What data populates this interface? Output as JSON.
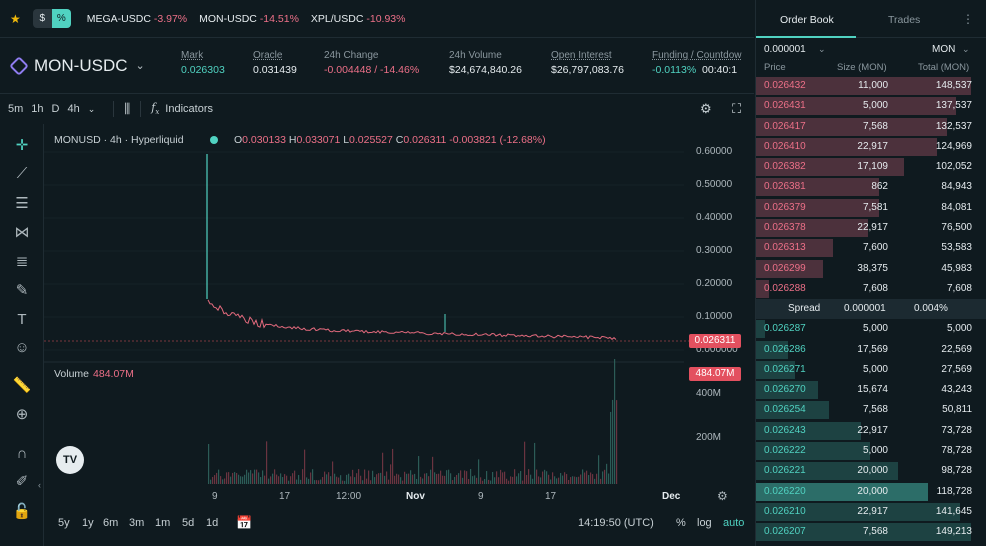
{
  "topbar": {
    "toggle_left": "$",
    "toggle_right": "%",
    "tickers": [
      {
        "symbol": "MEGA-USDC",
        "change": "-3.97%"
      },
      {
        "symbol": "MON-USDC",
        "change": "-14.51%"
      },
      {
        "symbol": "XPL/USDC",
        "change": "-10.93%"
      }
    ]
  },
  "header": {
    "pair": "MON-USDC",
    "stats": [
      {
        "label": "Mark",
        "value": "0.026303"
      },
      {
        "label": "Oracle",
        "value": "0.031439"
      },
      {
        "label": "24h Change",
        "value": "-0.004448 / -14.46%"
      },
      {
        "label": "24h Volume",
        "value": "$24,674,840.26"
      },
      {
        "label": "Open Interest",
        "value": "$26,797,083.76"
      },
      {
        "label": "Funding / Countdow",
        "value": "-0.0113%",
        "extra": "00:40:1"
      }
    ]
  },
  "toolbar": {
    "timeframes": [
      "5m",
      "1h",
      "D",
      "4h"
    ],
    "indicators_label": "Indicators"
  },
  "chart": {
    "legend": "MONUSD · 4h · Hyperliquid",
    "ohlc": [
      {
        "k": "O",
        "v": "0.030133"
      },
      {
        "k": "H",
        "v": "0.033071"
      },
      {
        "k": "L",
        "v": "0.025527"
      },
      {
        "k": "C",
        "v": "0.026311"
      },
      {
        "k": "",
        "v": "-0.003821 (-12.68%)"
      }
    ],
    "price_axis": [
      "0.60000",
      "0.50000",
      "0.40000",
      "0.30000",
      "0.20000",
      "0.10000",
      "0.000000"
    ],
    "last_price": "0.026311",
    "volume_label": "Volume",
    "volume_value": "484.07M",
    "volume_axis": [
      "400M",
      "200M"
    ],
    "volume_tag": "484.07M",
    "x_axis": [
      "9",
      "17",
      "12:00",
      "Nov",
      "9",
      "17",
      "Dec"
    ]
  },
  "bottombar": {
    "ranges": [
      "5y",
      "1y",
      "6m",
      "3m",
      "1m",
      "5d",
      "1d"
    ],
    "time": "14:19:50 (UTC)",
    "pct": "%",
    "log": "log",
    "auto": "auto"
  },
  "orderbook": {
    "tabs": [
      "Order Book",
      "Trades"
    ],
    "tick_size": "0.000001",
    "unit": "MON",
    "headers": {
      "price": "Price",
      "size": "Size (MON)",
      "total": "Total (MON)"
    },
    "asks": [
      {
        "price": "0.026432",
        "size": "11,000",
        "total": "148,537",
        "depth": 1.0
      },
      {
        "price": "0.026431",
        "size": "5,000",
        "total": "137,537",
        "depth": 0.93
      },
      {
        "price": "0.026417",
        "size": "7,568",
        "total": "132,537",
        "depth": 0.89
      },
      {
        "price": "0.026410",
        "size": "22,917",
        "total": "124,969",
        "depth": 0.84
      },
      {
        "price": "0.026382",
        "size": "17,109",
        "total": "102,052",
        "depth": 0.69
      },
      {
        "price": "0.026381",
        "size": "862",
        "total": "84,943",
        "depth": 0.57
      },
      {
        "price": "0.026379",
        "size": "7,581",
        "total": "84,081",
        "depth": 0.57
      },
      {
        "price": "0.026378",
        "size": "22,917",
        "total": "76,500",
        "depth": 0.52
      },
      {
        "price": "0.026313",
        "size": "7,600",
        "total": "53,583",
        "depth": 0.36
      },
      {
        "price": "0.026299",
        "size": "38,375",
        "total": "45,983",
        "depth": 0.31
      },
      {
        "price": "0.026288",
        "size": "7,608",
        "total": "7,608",
        "depth": 0.06
      }
    ],
    "spread": {
      "label": "Spread",
      "value": "0.000001",
      "pct": "0.004%"
    },
    "bids": [
      {
        "price": "0.026287",
        "size": "5,000",
        "total": "5,000",
        "depth": 0.04
      },
      {
        "price": "0.026286",
        "size": "17,569",
        "total": "22,569",
        "depth": 0.15
      },
      {
        "price": "0.026271",
        "size": "5,000",
        "total": "27,569",
        "depth": 0.18
      },
      {
        "price": "0.026270",
        "size": "15,674",
        "total": "43,243",
        "depth": 0.29
      },
      {
        "price": "0.026254",
        "size": "7,568",
        "total": "50,811",
        "depth": 0.34
      },
      {
        "price": "0.026243",
        "size": "22,917",
        "total": "73,728",
        "depth": 0.49
      },
      {
        "price": "0.026222",
        "size": "5,000",
        "total": "78,728",
        "depth": 0.53
      },
      {
        "price": "0.026221",
        "size": "20,000",
        "total": "98,728",
        "depth": 0.66
      },
      {
        "price": "0.026220",
        "size": "20,000",
        "total": "118,728",
        "depth": 0.8
      },
      {
        "price": "0.026210",
        "size": "22,917",
        "total": "141,645",
        "depth": 0.95
      },
      {
        "price": "0.026207",
        "size": "7,568",
        "total": "149,213",
        "depth": 1.0
      }
    ]
  },
  "colors": {
    "up": "#50d2c1",
    "down": "#ed7088",
    "bg": "#0f1a1f"
  }
}
